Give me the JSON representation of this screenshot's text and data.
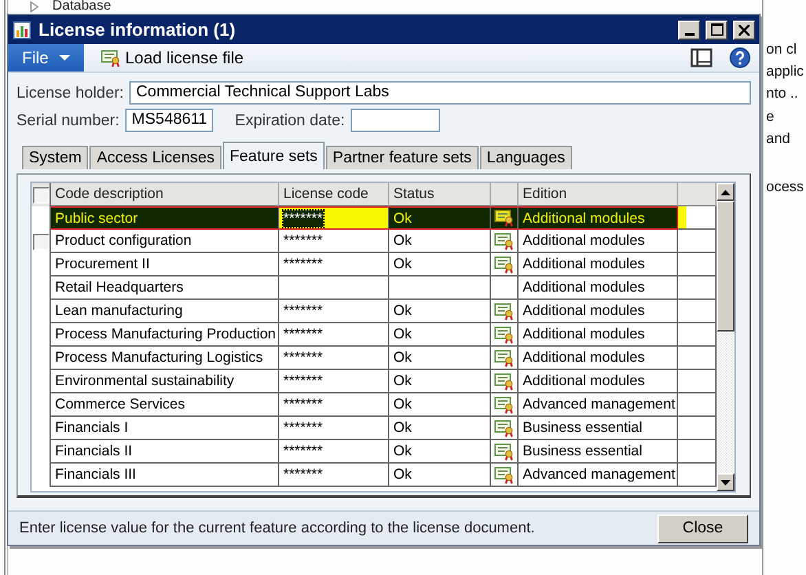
{
  "background": {
    "tree_item": "Database",
    "texts_top": [
      "on cl",
      "applic",
      "nto ..",
      "e",
      "and"
    ],
    "texts_bottom": [
      "ocess"
    ]
  },
  "window": {
    "title": "License information (1)"
  },
  "toolbar": {
    "file_menu": "File",
    "load_button": "Load license file"
  },
  "fields": {
    "license_holder": {
      "label": "License holder:",
      "value": "Commercial Technical Support Labs"
    },
    "serial_number": {
      "label": "Serial number:",
      "value": "MS548611"
    },
    "expiration_date": {
      "label": "Expiration date:"
    }
  },
  "tabs": [
    {
      "label": "System",
      "selected": false
    },
    {
      "label": "Access Licenses",
      "selected": false
    },
    {
      "label": "Feature sets",
      "selected": true
    },
    {
      "label": "Partner feature sets",
      "selected": false
    },
    {
      "label": "Languages",
      "selected": false
    }
  ],
  "table": {
    "columns": [
      "Code description",
      "License code",
      "Status",
      "Edition"
    ],
    "select_all": {
      "checked": false
    },
    "rows": [
      {
        "description": "Public sector",
        "license_code": "*******",
        "status": "Ok",
        "certificate": true,
        "edition": "Additional modules",
        "selected": true,
        "mark_box_visible": false
      },
      {
        "description": "Product configuration",
        "license_code": "*******",
        "status": "Ok",
        "certificate": true,
        "edition": "Additional modules",
        "selected": false,
        "mark_box_visible": true
      },
      {
        "description": "Procurement II",
        "license_code": "*******",
        "status": "Ok",
        "certificate": true,
        "edition": "Additional modules",
        "selected": false,
        "mark_box_visible": false
      },
      {
        "description": "Retail Headquarters",
        "license_code": "",
        "status": "",
        "certificate": false,
        "edition": "Additional modules",
        "selected": false,
        "mark_box_visible": false
      },
      {
        "description": "Lean manufacturing",
        "license_code": "*******",
        "status": "Ok",
        "certificate": true,
        "edition": "Additional modules",
        "selected": false,
        "mark_box_visible": false
      },
      {
        "description": "Process Manufacturing Production",
        "license_code": "*******",
        "status": "Ok",
        "certificate": true,
        "edition": "Additional modules",
        "selected": false,
        "mark_box_visible": false
      },
      {
        "description": "Process Manufacturing Logistics",
        "license_code": "*******",
        "status": "Ok",
        "certificate": true,
        "edition": "Additional modules",
        "selected": false,
        "mark_box_visible": false
      },
      {
        "description": "Environmental sustainability",
        "license_code": "*******",
        "status": "Ok",
        "certificate": true,
        "edition": "Additional modules",
        "selected": false,
        "mark_box_visible": false
      },
      {
        "description": "Commerce Services",
        "license_code": "*******",
        "status": "Ok",
        "certificate": true,
        "edition": "Advanced management",
        "selected": false,
        "mark_box_visible": false
      },
      {
        "description": "Financials I",
        "license_code": "*******",
        "status": "Ok",
        "certificate": true,
        "edition": "Business essential",
        "selected": false,
        "mark_box_visible": false
      },
      {
        "description": "Financials II",
        "license_code": "*******",
        "status": "Ok",
        "certificate": true,
        "edition": "Business essential",
        "selected": false,
        "mark_box_visible": false
      },
      {
        "description": "Financials III",
        "license_code": "*******",
        "status": "Ok",
        "certificate": true,
        "edition": "Advanced management",
        "selected": false,
        "mark_box_visible": false
      }
    ]
  },
  "status_bar": {
    "message": "Enter license value for the current feature according to the license document."
  },
  "buttons": {
    "close": "Close"
  }
}
